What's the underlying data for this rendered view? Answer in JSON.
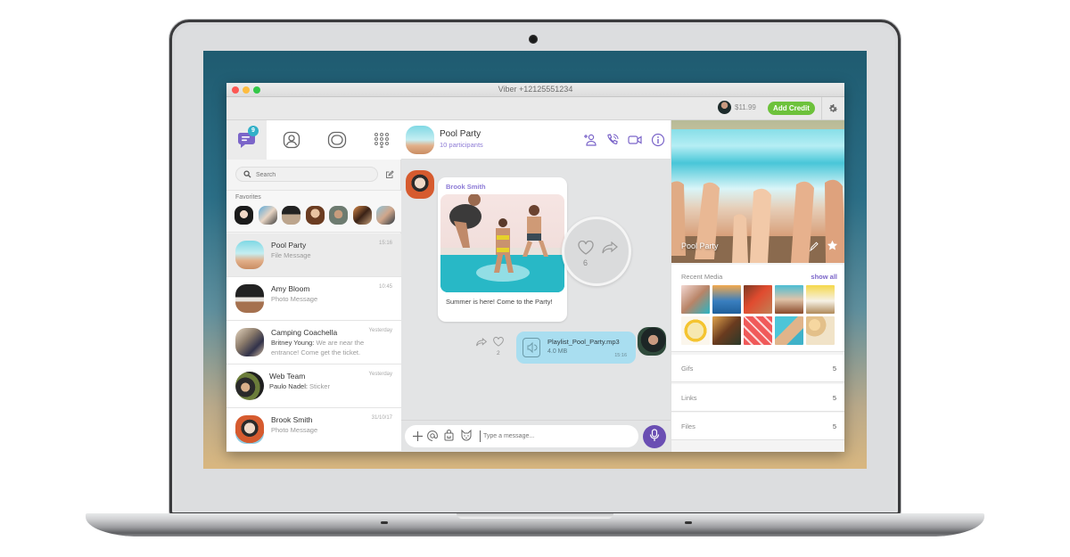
{
  "window": {
    "title": "Viber +12125551234"
  },
  "toolbar": {
    "balance": "$11.99",
    "add_credit_label": "Add Credit",
    "settings_icon": "gear-icon"
  },
  "sidebar": {
    "nav": [
      {
        "name": "chats",
        "icon": "chat-bubble-icon",
        "badge": "9",
        "active": true
      },
      {
        "name": "contacts",
        "icon": "contact-icon",
        "active": false
      },
      {
        "name": "public-accounts",
        "icon": "public-chat-icon",
        "active": false
      },
      {
        "name": "more",
        "icon": "grid-dots-icon",
        "active": false
      }
    ],
    "search": {
      "placeholder": "Search",
      "value": ""
    },
    "favorites_label": "Favorites",
    "favorites_count": 7,
    "chats": [
      {
        "name": "Pool Party",
        "sender": "",
        "preview": "File Message",
        "time": "15:16",
        "selected": true
      },
      {
        "name": "Amy Bloom",
        "sender": "",
        "preview": "Photo Message",
        "time": "10:45",
        "selected": false
      },
      {
        "name": "Camping Coachella",
        "sender": "Britney Young:",
        "preview": "We are near the entrance! Come get the ticket.",
        "time": "Yesterday",
        "selected": false
      },
      {
        "name": "Web Team",
        "sender": "Paulo Nadel:",
        "preview": "Sticker",
        "time": "Yesterday",
        "selected": false
      },
      {
        "name": "Brook Smith",
        "sender": "",
        "preview": "Photo Message",
        "time": "31/10/17",
        "selected": false
      }
    ]
  },
  "conversation": {
    "title": "Pool Party",
    "subtitle": "10 participants",
    "header_icons": [
      "add-participant-icon",
      "phone-icon",
      "video-icon",
      "info-icon"
    ],
    "messages": [
      {
        "sender": "Brook Smith",
        "type": "photo",
        "caption": "Summer is here! Come to the Party!",
        "likes": "6"
      },
      {
        "sender": "me",
        "type": "file",
        "file_name": "Playlist_Pool_Party.mp3",
        "file_size": "4.0 MB",
        "time": "15:16",
        "likes": "2"
      }
    ],
    "composer": {
      "placeholder": "Type a message...",
      "icons": [
        "plus-icon",
        "at-icon",
        "shopping-bag-icon",
        "sticker-cat-icon",
        "microphone-icon"
      ]
    }
  },
  "info_panel": {
    "cover_title": "Pool Party",
    "recent_media_label": "Recent Media",
    "show_all_label": "show all",
    "media_count": 10,
    "rows": [
      {
        "label": "Gifs",
        "value": "5"
      },
      {
        "label": "Links",
        "value": "5"
      },
      {
        "label": "Files",
        "value": "5"
      }
    ]
  },
  "colors": {
    "accent_purple": "#7b65c9",
    "add_credit_green": "#6dc23b",
    "badge_teal": "#31b0c8",
    "file_bubble_blue": "#a9def0",
    "mic_button": "#6a4eb3"
  }
}
